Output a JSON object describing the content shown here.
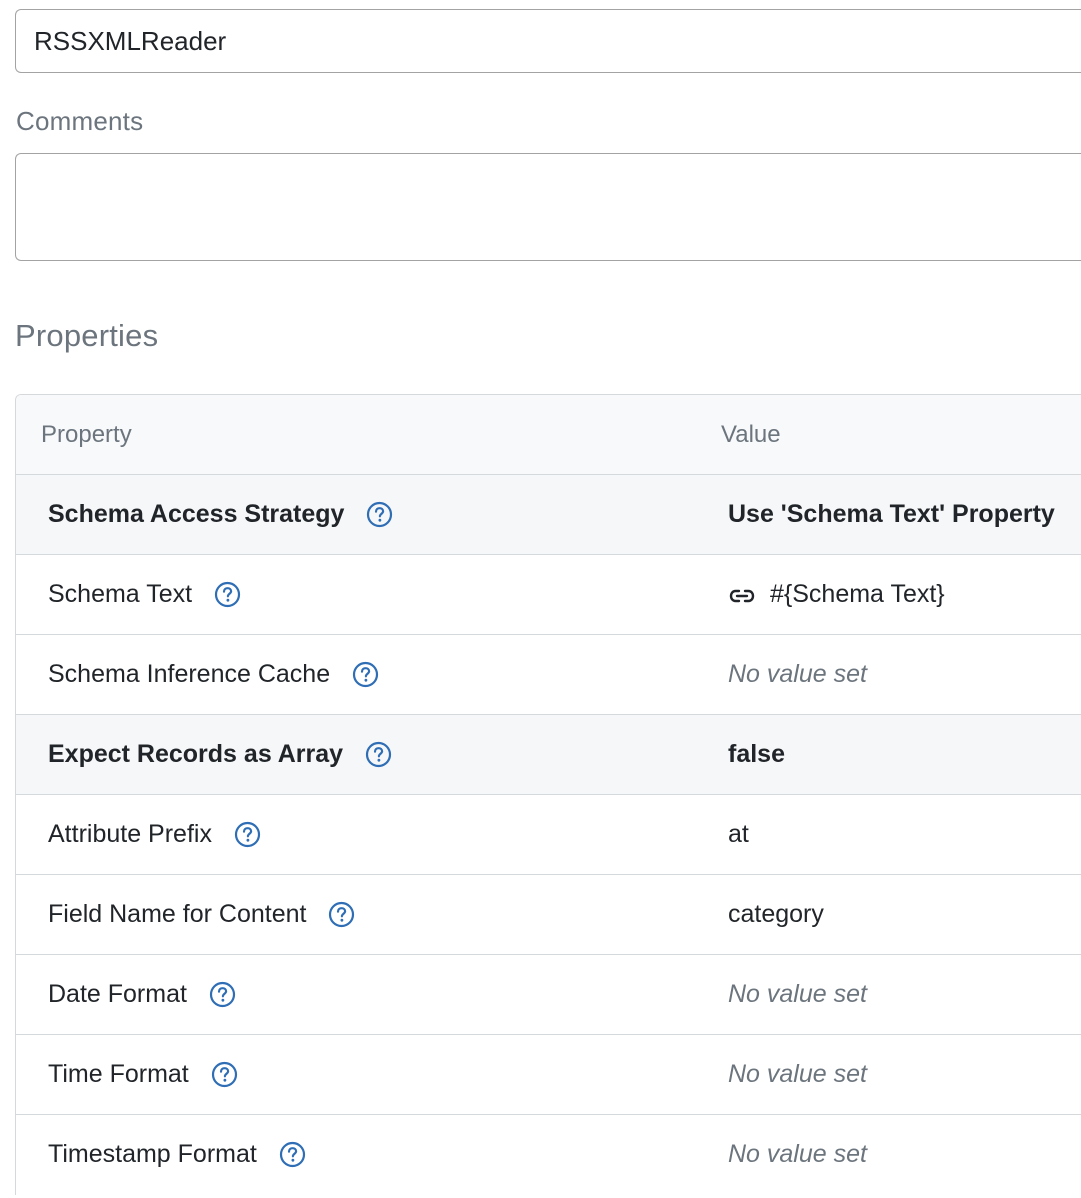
{
  "form": {
    "name_value": "RSSXMLReader",
    "comments_label": "Comments",
    "comments_value": ""
  },
  "properties": {
    "section_title": "Properties",
    "headers": {
      "property": "Property",
      "value": "Value"
    },
    "rows": [
      {
        "name": "Schema Access Strategy",
        "value": "Use 'Schema Text' Property",
        "bold": true,
        "empty": false,
        "link": false
      },
      {
        "name": "Schema Text",
        "value": "#{Schema Text}",
        "bold": false,
        "empty": false,
        "link": true
      },
      {
        "name": "Schema Inference Cache",
        "value": "No value set",
        "bold": false,
        "empty": true,
        "link": false
      },
      {
        "name": "Expect Records as Array",
        "value": "false",
        "bold": true,
        "empty": false,
        "link": false
      },
      {
        "name": "Attribute Prefix",
        "value": "at",
        "bold": false,
        "empty": false,
        "link": false
      },
      {
        "name": "Field Name for Content",
        "value": "category",
        "bold": false,
        "empty": false,
        "link": false
      },
      {
        "name": "Date Format",
        "value": "No value set",
        "bold": false,
        "empty": true,
        "link": false
      },
      {
        "name": "Time Format",
        "value": "No value set",
        "bold": false,
        "empty": true,
        "link": false
      },
      {
        "name": "Timestamp Format",
        "value": "No value set",
        "bold": false,
        "empty": true,
        "link": false
      }
    ]
  },
  "colors": {
    "help_icon": "#2f6eb5",
    "muted_text": "#6c757d",
    "border": "#d6d9dc",
    "highlight_row": "#f6f7f8"
  },
  "icons": {
    "help": "question-circle-icon",
    "parameter_link": "link-icon"
  }
}
